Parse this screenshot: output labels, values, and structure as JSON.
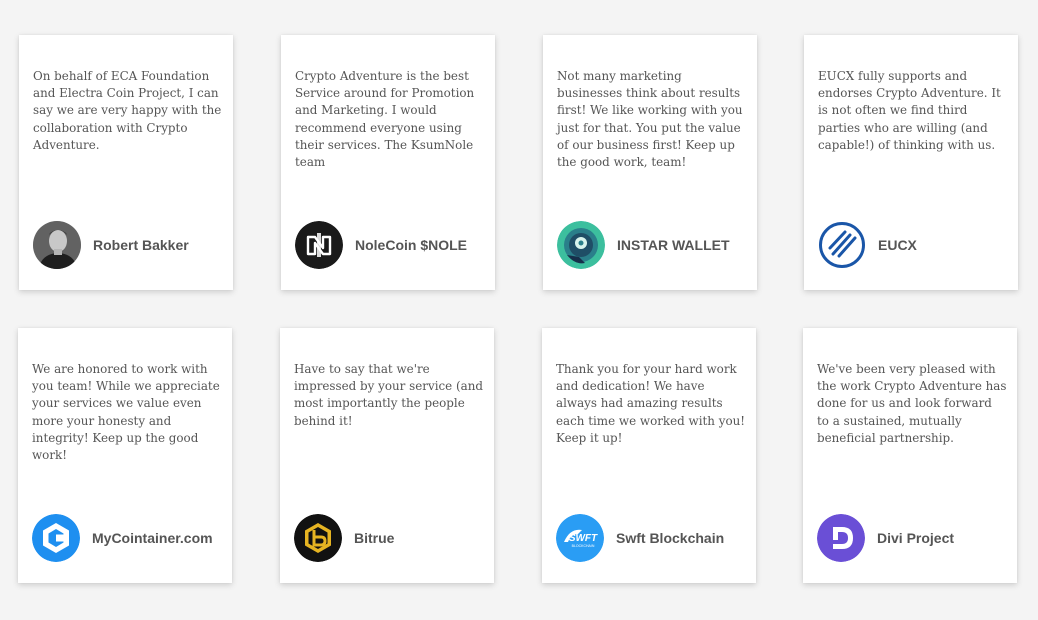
{
  "testimonials": [
    {
      "quote": "On behalf of ECA Foundation and Electra Coin Project, I can say we are very happy with the collaboration with Crypto Adventure.",
      "name": "Robert Bakker",
      "icon": "person-photo-icon"
    },
    {
      "quote": "Crypto Adventure is the best Service around for Promotion and Marketing. I would recommend everyone using their services. The KsumNole team",
      "name": "NoleCoin $NOLE",
      "icon": "nolecoin-logo-icon",
      "color": "#1a1a1a"
    },
    {
      "quote": "Not many marketing businesses think about results first! We like working with you just for that. You put the value of our business first! Keep up the good work, team!",
      "name": "INSTAR WALLET",
      "icon": "instar-wallet-logo-icon",
      "color": "#35b59a"
    },
    {
      "quote": "EUCX fully supports and endorses Crypto Adventure. It is not often we find third parties who are willing (and capable!) of thinking with us.",
      "name": "EUCX",
      "icon": "eucx-logo-icon",
      "color": "#1a56a8"
    },
    {
      "quote": "We are honored to work with you team! While we appreciate your services we value even more your honesty and integrity! Keep up the good work!",
      "name": "MyCointainer.com",
      "icon": "mycointainer-logo-icon",
      "color": "#1e8ff0"
    },
    {
      "quote": "Have to say that we're impressed by your service (and most importantly the people behind it!",
      "name": "Bitrue",
      "icon": "bitrue-logo-icon",
      "color": "#e6b422"
    },
    {
      "quote": "Thank you for your hard work and dedication! We have always had amazing results each time we worked with you! Keep it up!",
      "name": "Swft Blockchain",
      "icon": "swft-blockchain-logo-icon",
      "color": "#2a9df4"
    },
    {
      "quote": "We've been very pleased with the work Crypto Adventure has done for us and look forward to a sustained, mutually beneficial partnership.",
      "name": "Divi Project",
      "icon": "divi-project-logo-icon",
      "color": "#6a4fd6"
    }
  ],
  "logo_texts": {
    "swft": "SWFT",
    "swft_sub": "BLOCKCHAIN"
  }
}
